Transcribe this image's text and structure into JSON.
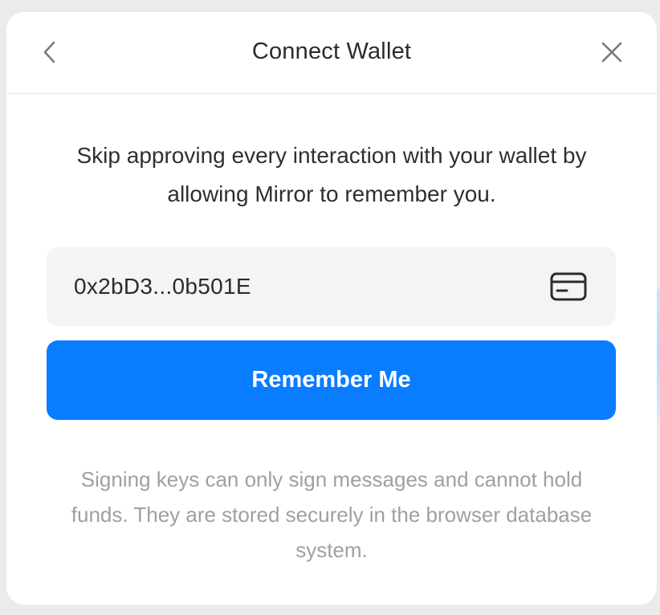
{
  "header": {
    "title": "Connect Wallet",
    "back_icon": "chevron-left-icon",
    "close_icon": "close-icon"
  },
  "main": {
    "description": "Skip approving every interaction with your wallet by allowing Mirror to remember you.",
    "wallet_address": "0x2bD3...0b501E",
    "wallet_icon": "card-icon",
    "primary_button_label": "Remember Me",
    "footnote": "Signing keys can only sign messages and cannot hold funds. They are stored securely in the browser database system."
  },
  "colors": {
    "accent": "#0a7cff",
    "text_primary": "#2b2b2b",
    "text_muted": "#a0a0a0",
    "field_background": "#f4f4f4",
    "page_background": "#ebebeb"
  }
}
